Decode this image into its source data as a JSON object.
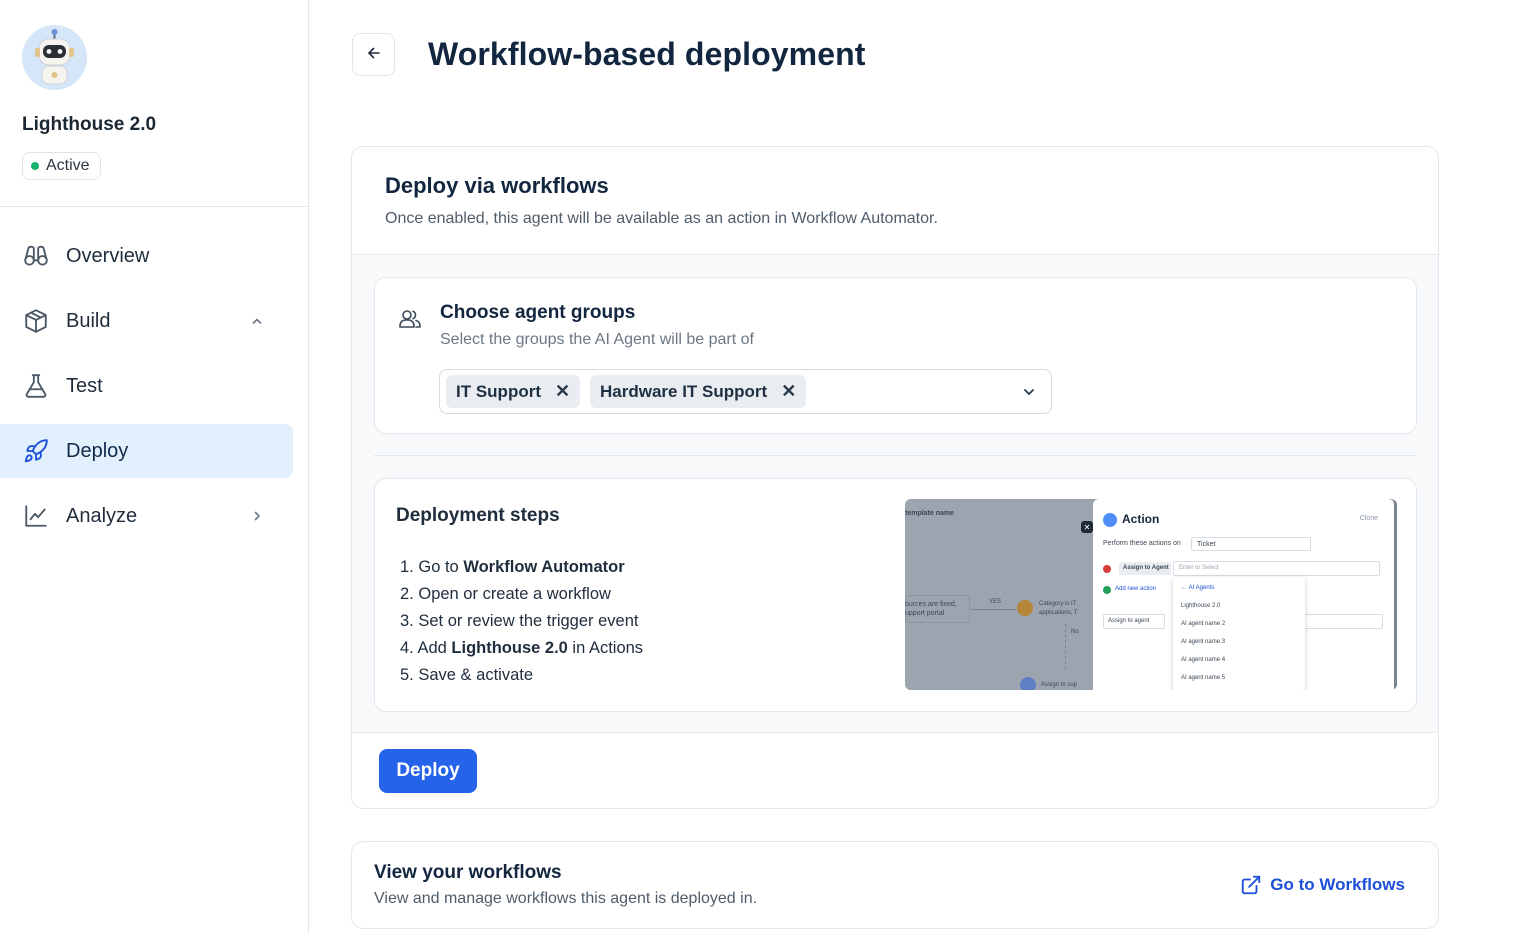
{
  "agent": {
    "name": "Lighthouse 2.0",
    "status": "Active"
  },
  "sidebar": {
    "items": [
      {
        "label": "Overview",
        "icon": "binoculars-icon"
      },
      {
        "label": "Build",
        "icon": "box-icon",
        "expanded": true
      },
      {
        "label": "Test",
        "icon": "flask-icon"
      },
      {
        "label": "Deploy",
        "icon": "rocket-icon",
        "active": true
      },
      {
        "label": "Analyze",
        "icon": "chart-line-icon"
      }
    ]
  },
  "header": {
    "title": "Workflow-based deployment"
  },
  "deploy_section": {
    "title": "Deploy via workflows",
    "description": "Once enabled, this agent will be available as an action in Workflow Automator.",
    "groups": {
      "title": "Choose agent groups",
      "description": "Select the groups the AI Agent will be part of",
      "selected": [
        "IT Support",
        "Hardware IT Support"
      ]
    },
    "steps": {
      "title": "Deployment steps",
      "items": [
        {
          "num": "1.",
          "pre": "Go to ",
          "bold": "Workflow Automator",
          "post": ""
        },
        {
          "num": "2.",
          "pre": "Open or create a workflow",
          "bold": "",
          "post": ""
        },
        {
          "num": "3.",
          "pre": "Set or review the trigger event",
          "bold": "",
          "post": ""
        },
        {
          "num": "4.",
          "pre": "Add ",
          "bold": "Lighthouse 2.0",
          "post": " in Actions"
        },
        {
          "num": "5.",
          "pre": "Save & activate",
          "bold": "",
          "post": ""
        }
      ]
    },
    "preview": {
      "left_label": "template name",
      "node_label_a": "ources are fixed,",
      "node_label_b": "upport portal",
      "yes_label": "YES",
      "category_a": "Category is IT",
      "category_b": "applications, T",
      "no_label": "No",
      "assign_label": "Assign to sup",
      "panel_title": "Action",
      "clone_label": "Clone",
      "perform_label": "Perform these actions on",
      "perform_value": "Ticket",
      "assign_agent_label": "Assign to Agent",
      "enter_select_placeholder": "Enter or Select",
      "add_action_label": "Add new action",
      "assign_to_agent_label": "Assign to agent",
      "dropdown_header": "AI Agents",
      "dropdown_items": [
        "Lighthouse 2.0",
        "AI agent name 2",
        "AI agent name 3",
        "AI agent name 4",
        "AI agent name 5"
      ]
    },
    "deploy_button": "Deploy"
  },
  "workflows": {
    "title": "View your workflows",
    "description": "View and manage workflows this agent is deployed in.",
    "link": "Go to Workflows"
  },
  "colors": {
    "accent": "#2563eb",
    "active_nav_bg": "#e2effc",
    "status_green": "#17b26a"
  }
}
